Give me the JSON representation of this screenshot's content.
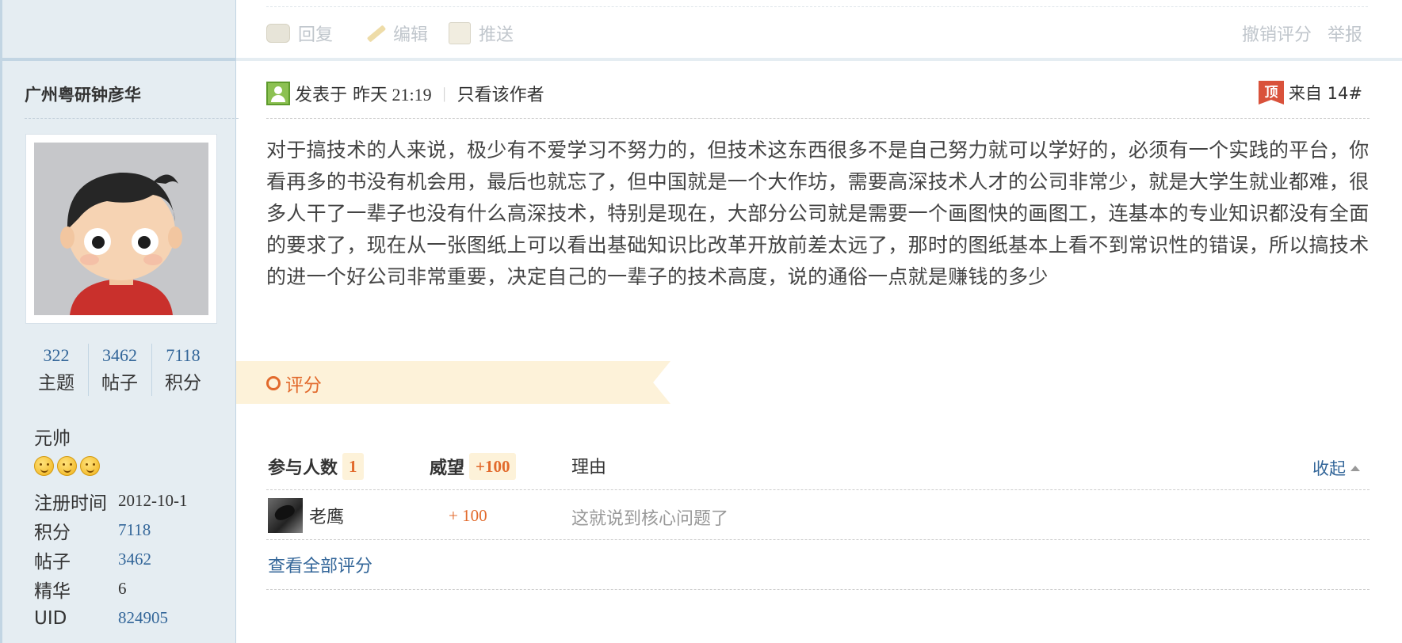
{
  "user": {
    "name": "广州粤研钟彦华",
    "stats": [
      {
        "value": "322",
        "label": "主题"
      },
      {
        "value": "3462",
        "label": "帖子"
      },
      {
        "value": "7118",
        "label": "积分"
      }
    ],
    "rank": "元帅",
    "info": {
      "reg_key": "注册时间",
      "reg_val": "2012-10-1",
      "points_key": "积分",
      "points_val": "7118",
      "posts_key": "帖子",
      "posts_val": "3462",
      "digest_key": "精华",
      "digest_val": "6",
      "uid_key": "UID",
      "uid_val": "824905"
    }
  },
  "actions": {
    "reply": "回复",
    "edit": "编辑",
    "push": "推送",
    "cancel_rate": "撤销评分",
    "report": "举报"
  },
  "post": {
    "posted_prefix": "发表于",
    "posted_time": "昨天 21:19",
    "only_author": "只看该作者",
    "top_badge": "顶",
    "from": "来自 14#",
    "body": "对于搞技术的人来说，极少有不爱学习不努力的，但技术这东西很多不是自己努力就可以学好的，必须有一个实践的平台，你看再多的书没有机会用，最后也就忘了，但中国就是一个大作坊，需要高深技术人才的公司非常少，就是大学生就业都难，很多人干了一辈子也没有什么高深技术，特别是现在，大部分公司就是需要一个画图快的画图工，连基本的专业知识都没有全面的要求了，现在从一张图纸上可以看出基础知识比改革开放前差太远了，那时的图纸基本上看不到常识性的错误，所以搞技术的进一个好公司非常重要，决定自己的一辈子的技术高度，说的通俗一点就是赚钱的多少"
  },
  "rating": {
    "section_title": "评分",
    "participants_label": "参与人数",
    "participants_count": "1",
    "prestige_label": "威望",
    "prestige_total": "+100",
    "reason_label": "理由",
    "collapse": "收起",
    "entries": [
      {
        "user": "老鹰",
        "score": "+ 100",
        "reason": "这就说到核心问题了"
      }
    ],
    "view_all": "查看全部评分"
  }
}
